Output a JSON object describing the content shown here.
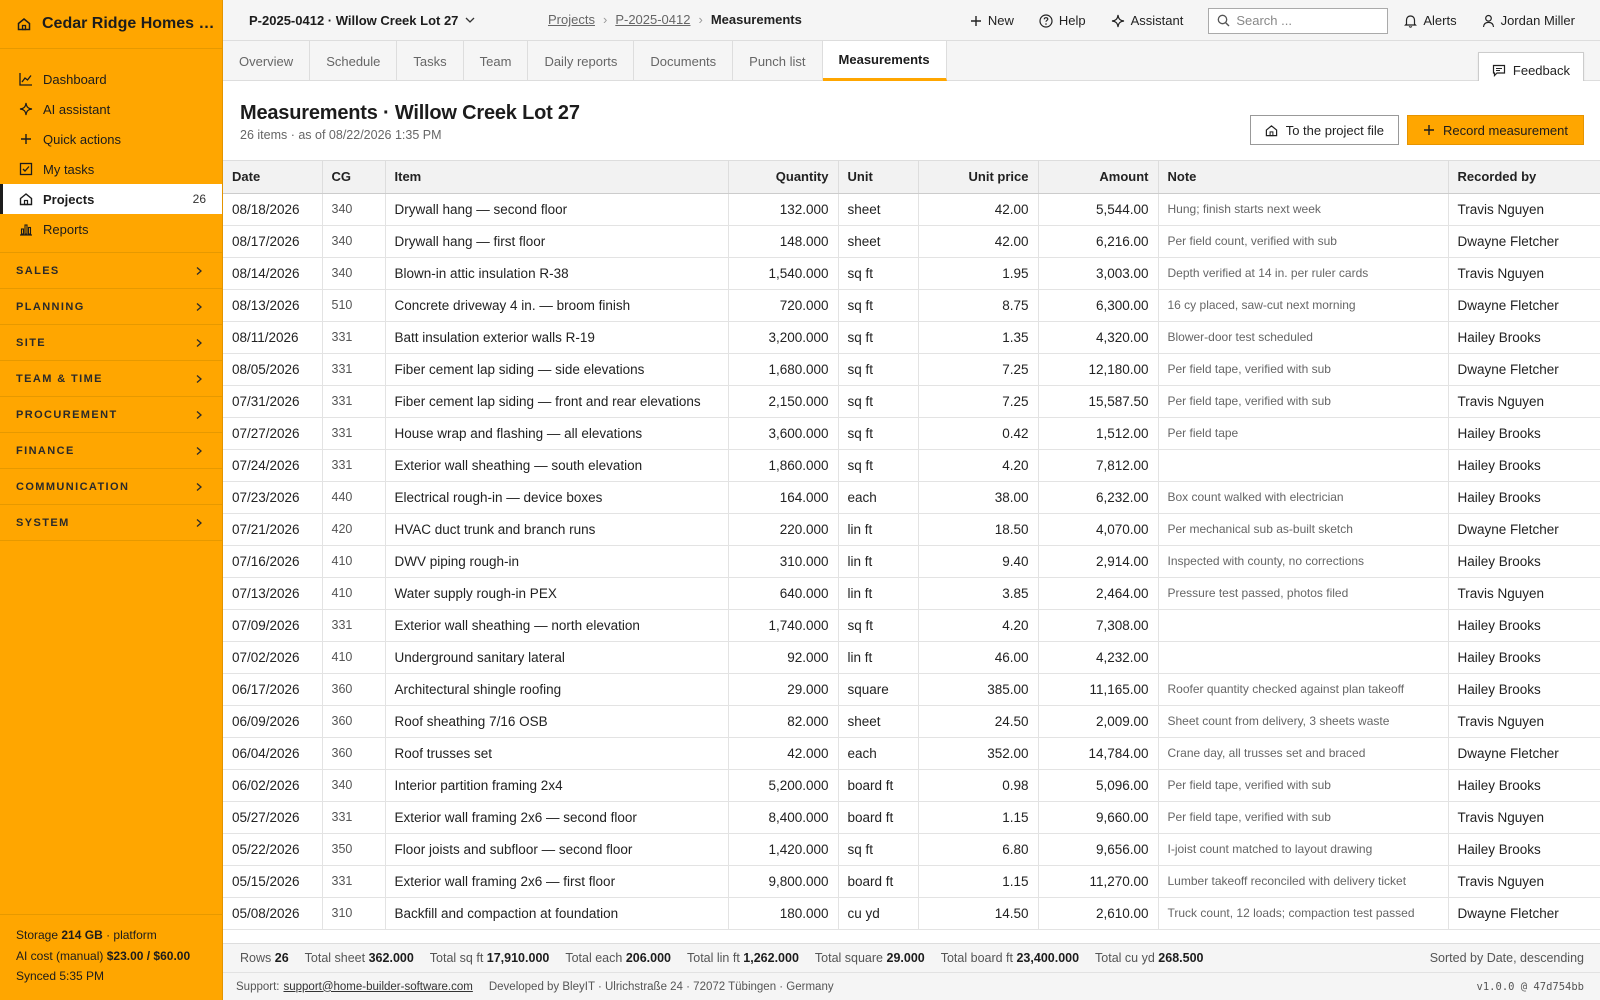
{
  "brand": {
    "name": "Cedar Ridge Homes LLC"
  },
  "sidebar": {
    "items": [
      {
        "label": "Dashboard",
        "icon": "chart-line-icon"
      },
      {
        "label": "AI assistant",
        "icon": "sparkle-icon"
      },
      {
        "label": "Quick actions",
        "icon": "plus-icon"
      },
      {
        "label": "My tasks",
        "icon": "checkbox-icon"
      },
      {
        "label": "Projects",
        "icon": "home-icon",
        "count": "26",
        "active": true
      },
      {
        "label": "Reports",
        "icon": "bar-chart-icon"
      }
    ],
    "sections": [
      "SALES",
      "PLANNING",
      "SITE",
      "TEAM & TIME",
      "PROCUREMENT",
      "FINANCE",
      "COMMUNICATION",
      "SYSTEM"
    ],
    "footer": {
      "storage_label": "Storage",
      "storage_value": "214 GB",
      "storage_suffix": "· platform",
      "ai_label": "AI cost (manual)",
      "ai_value": "$23.00 / $60.00",
      "synced": "Synced 5:35 PM"
    }
  },
  "topbar": {
    "project": "P-2025-0412 · Willow Creek Lot 27",
    "breadcrumb": {
      "projects": "Projects",
      "project_id": "P-2025-0412",
      "current": "Measurements"
    },
    "new_label": "New",
    "help_label": "Help",
    "assistant_label": "Assistant",
    "search_placeholder": "Search ...",
    "alerts_label": "Alerts",
    "user_name": "Jordan Miller"
  },
  "tabs": [
    "Overview",
    "Schedule",
    "Tasks",
    "Team",
    "Daily reports",
    "Documents",
    "Punch list",
    "Measurements"
  ],
  "active_tab": "Measurements",
  "feedback_label": "Feedback",
  "header": {
    "title": "Measurements · Willow Creek Lot 27",
    "subtitle": "26 items · as of 08/22/2026 1:35 PM",
    "file_button": "To the project file",
    "record_button": "Record measurement"
  },
  "table": {
    "columns": [
      "Date",
      "CG",
      "Item",
      "Quantity",
      "Unit",
      "Unit price",
      "Amount",
      "Note",
      "Recorded by"
    ],
    "rows": [
      [
        "08/18/2026",
        "340",
        "Drywall hang — second floor",
        "132.000",
        "sheet",
        "42.00",
        "5,544.00",
        "Hung; finish starts next week",
        "Travis Nguyen"
      ],
      [
        "08/17/2026",
        "340",
        "Drywall hang — first floor",
        "148.000",
        "sheet",
        "42.00",
        "6,216.00",
        "Per field count, verified with sub",
        "Dwayne Fletcher"
      ],
      [
        "08/14/2026",
        "340",
        "Blown-in attic insulation R-38",
        "1,540.000",
        "sq ft",
        "1.95",
        "3,003.00",
        "Depth verified at 14 in. per ruler cards",
        "Travis Nguyen"
      ],
      [
        "08/13/2026",
        "510",
        "Concrete driveway 4 in. — broom finish",
        "720.000",
        "sq ft",
        "8.75",
        "6,300.00",
        "16 cy placed, saw-cut next morning",
        "Dwayne Fletcher"
      ],
      [
        "08/11/2026",
        "331",
        "Batt insulation exterior walls R-19",
        "3,200.000",
        "sq ft",
        "1.35",
        "4,320.00",
        "Blower-door test scheduled",
        "Hailey Brooks"
      ],
      [
        "08/05/2026",
        "331",
        "Fiber cement lap siding — side elevations",
        "1,680.000",
        "sq ft",
        "7.25",
        "12,180.00",
        "Per field tape, verified with sub",
        "Dwayne Fletcher"
      ],
      [
        "07/31/2026",
        "331",
        "Fiber cement lap siding — front and rear elevations",
        "2,150.000",
        "sq ft",
        "7.25",
        "15,587.50",
        "Per field tape, verified with sub",
        "Travis Nguyen"
      ],
      [
        "07/27/2026",
        "331",
        "House wrap and flashing — all elevations",
        "3,600.000",
        "sq ft",
        "0.42",
        "1,512.00",
        "Per field tape",
        "Hailey Brooks"
      ],
      [
        "07/24/2026",
        "331",
        "Exterior wall sheathing — south elevation",
        "1,860.000",
        "sq ft",
        "4.20",
        "7,812.00",
        "",
        "Hailey Brooks"
      ],
      [
        "07/23/2026",
        "440",
        "Electrical rough-in — device boxes",
        "164.000",
        "each",
        "38.00",
        "6,232.00",
        "Box count walked with electrician",
        "Hailey Brooks"
      ],
      [
        "07/21/2026",
        "420",
        "HVAC duct trunk and branch runs",
        "220.000",
        "lin ft",
        "18.50",
        "4,070.00",
        "Per mechanical sub as-built sketch",
        "Dwayne Fletcher"
      ],
      [
        "07/16/2026",
        "410",
        "DWV piping rough-in",
        "310.000",
        "lin ft",
        "9.40",
        "2,914.00",
        "Inspected with county, no corrections",
        "Hailey Brooks"
      ],
      [
        "07/13/2026",
        "410",
        "Water supply rough-in PEX",
        "640.000",
        "lin ft",
        "3.85",
        "2,464.00",
        "Pressure test passed, photos filed",
        "Travis Nguyen"
      ],
      [
        "07/09/2026",
        "331",
        "Exterior wall sheathing — north elevation",
        "1,740.000",
        "sq ft",
        "4.20",
        "7,308.00",
        "",
        "Hailey Brooks"
      ],
      [
        "07/02/2026",
        "410",
        "Underground sanitary lateral",
        "92.000",
        "lin ft",
        "46.00",
        "4,232.00",
        "",
        "Hailey Brooks"
      ],
      [
        "06/17/2026",
        "360",
        "Architectural shingle roofing",
        "29.000",
        "square",
        "385.00",
        "11,165.00",
        "Roofer quantity checked against plan takeoff",
        "Hailey Brooks"
      ],
      [
        "06/09/2026",
        "360",
        "Roof sheathing 7/16 OSB",
        "82.000",
        "sheet",
        "24.50",
        "2,009.00",
        "Sheet count from delivery, 3 sheets waste",
        "Travis Nguyen"
      ],
      [
        "06/04/2026",
        "360",
        "Roof trusses set",
        "42.000",
        "each",
        "352.00",
        "14,784.00",
        "Crane day, all trusses set and braced",
        "Dwayne Fletcher"
      ],
      [
        "06/02/2026",
        "340",
        "Interior partition framing 2x4",
        "5,200.000",
        "board ft",
        "0.98",
        "5,096.00",
        "Per field tape, verified with sub",
        "Hailey Brooks"
      ],
      [
        "05/27/2026",
        "331",
        "Exterior wall framing 2x6 — second floor",
        "8,400.000",
        "board ft",
        "1.15",
        "9,660.00",
        "Per field tape, verified with sub",
        "Travis Nguyen"
      ],
      [
        "05/22/2026",
        "350",
        "Floor joists and subfloor — second floor",
        "1,420.000",
        "sq ft",
        "6.80",
        "9,656.00",
        "I-joist count matched to layout drawing",
        "Hailey Brooks"
      ],
      [
        "05/15/2026",
        "331",
        "Exterior wall framing 2x6 — first floor",
        "9,800.000",
        "board ft",
        "1.15",
        "11,270.00",
        "Lumber takeoff reconciled with delivery ticket",
        "Travis Nguyen"
      ],
      [
        "05/08/2026",
        "310",
        "Backfill and compaction at foundation",
        "180.000",
        "cu yd",
        "14.50",
        "2,610.00",
        "Truck count, 12 loads; compaction test passed",
        "Dwayne Fletcher"
      ]
    ]
  },
  "totals": {
    "rows_label": "Rows",
    "rows_value": "26",
    "items": [
      {
        "label": "Total sheet",
        "value": "362.000"
      },
      {
        "label": "Total sq ft",
        "value": "17,910.000"
      },
      {
        "label": "Total each",
        "value": "206.000"
      },
      {
        "label": "Total lin ft",
        "value": "1,262.000"
      },
      {
        "label": "Total square",
        "value": "29.000"
      },
      {
        "label": "Total board ft",
        "value": "23,400.000"
      },
      {
        "label": "Total cu yd",
        "value": "268.500"
      }
    ],
    "sorted": "Sorted by Date, descending"
  },
  "support": {
    "label": "Support:",
    "email": "support@home-builder-software.com",
    "developer": "Developed by BleyIT · Ulrichstraße 24 · 72072 Tübingen · Germany",
    "version": "v1.0.0 @ 47d754bb"
  }
}
